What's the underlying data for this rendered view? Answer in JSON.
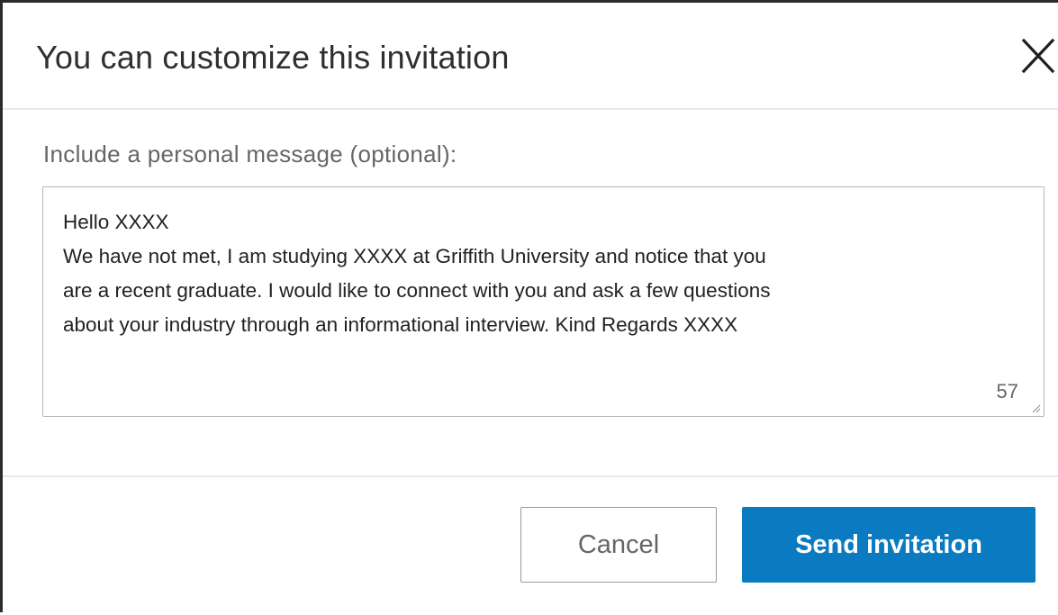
{
  "dialog": {
    "title": "You can customize this invitation",
    "close_icon": "close-icon"
  },
  "message": {
    "label": "Include a personal message (optional):",
    "value": "Hello XXXX\nWe have not met, I am studying XXXX at Griffith University and notice that you\nare a recent graduate. I would like to connect with you and ask a few questions\nabout your industry through an informational interview. Kind Regards XXXX",
    "remaining_chars": "57"
  },
  "actions": {
    "cancel_label": "Cancel",
    "send_label": "Send invitation"
  },
  "colors": {
    "primary": "#0a7bc1",
    "divider": "#e6e9ec",
    "text_muted": "#666666"
  }
}
